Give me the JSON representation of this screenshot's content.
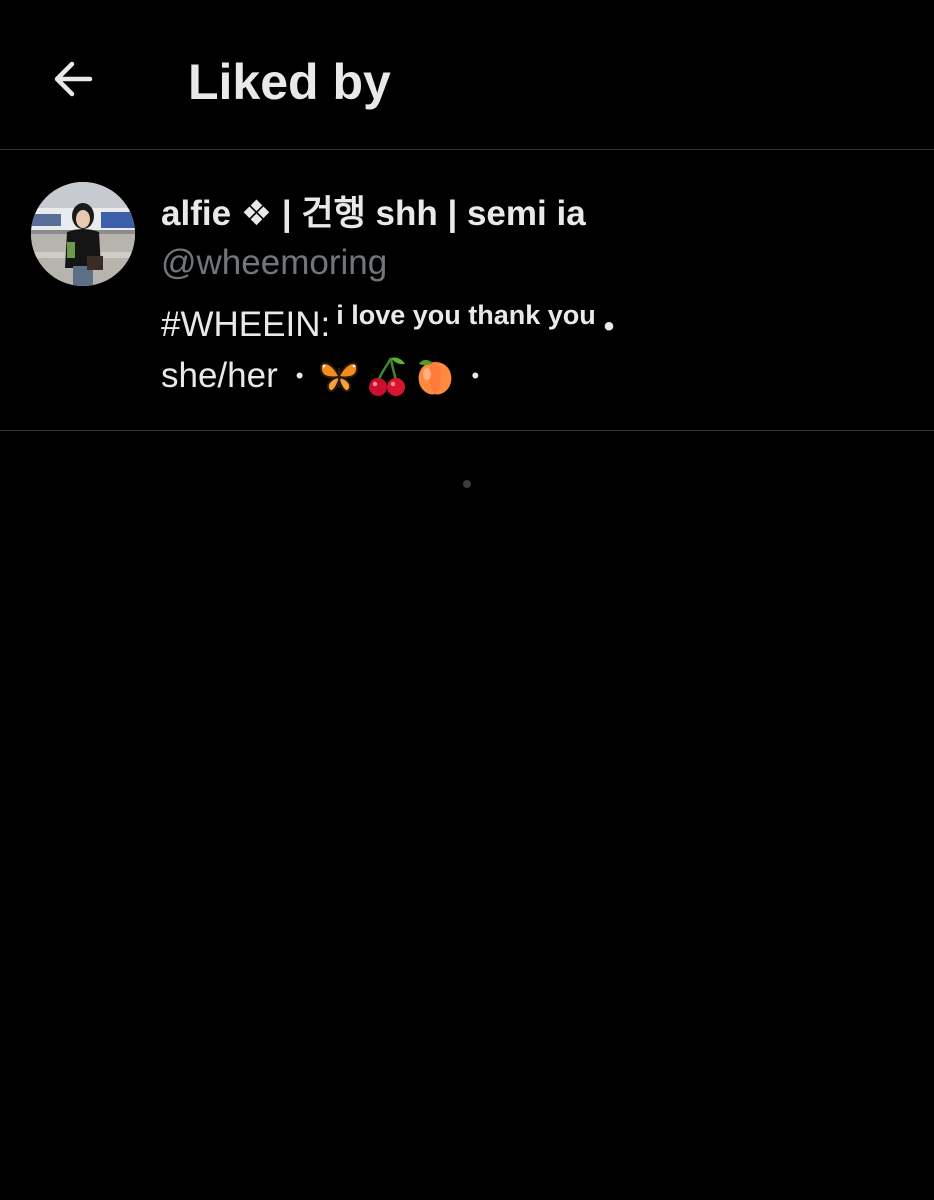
{
  "header": {
    "title": "Liked by",
    "back_icon": "arrow-left-icon"
  },
  "users": [
    {
      "display_name": "alfie ❖ | 건행 shh | semi ia",
      "handle": "@wheemoring",
      "bio": {
        "tag": "#WHEEIN:",
        "small_text": "i love you thank you",
        "dot": "•",
        "pronouns": "she/her",
        "separator": "•",
        "emojis": [
          "butterfly-icon",
          "cherries-icon",
          "peach-icon"
        ]
      },
      "avatar": "avatar-photo"
    }
  ],
  "colors": {
    "background": "#000000",
    "primary_text": "#e7e9ea",
    "secondary_text": "#71767b",
    "divider": "#2f3336"
  }
}
